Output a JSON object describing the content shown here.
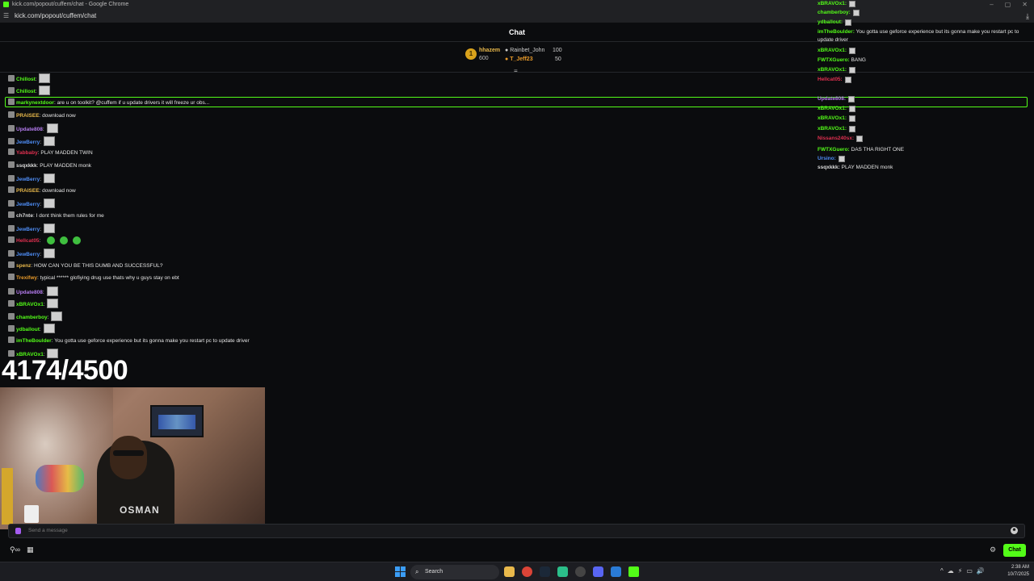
{
  "window": {
    "title": "kick.com/popout/cuffem/chat - Google Chrome",
    "url": "kick.com/popout/cuffem/chat"
  },
  "chat": {
    "header": "Chat",
    "input_placeholder": "Send a message",
    "chat_button": "Chat"
  },
  "leaderboard": {
    "first_name": "hhazem",
    "first_points": "600",
    "row1_name": "Rainbet_John",
    "row1_value": "100",
    "row2_name": "T_Jeff23",
    "row2_value": "50"
  },
  "overlay": {
    "counter": "4174/4500",
    "shirt_text": "OSMAN"
  },
  "messages": [
    {
      "user": "Chillost",
      "sep": ":",
      "text": "",
      "color": "#53fc18",
      "emote": true
    },
    {
      "user": "Chillost",
      "sep": ":",
      "text": "",
      "color": "#53fc18",
      "emote": true
    },
    {
      "user": "markynextdoor",
      "sep": ":",
      "text": "are u on toolkit? @cuffem if u update drivers it will freeze ur obs...",
      "color": "#53fc18",
      "emote": false
    },
    {
      "user": "PRAISEE",
      "sep": ":",
      "text": "download now",
      "color": "#e8b84b",
      "emote": false
    },
    {
      "user": "Update808",
      "sep": ":",
      "text": "",
      "color": "#b57cf0",
      "emote": true
    },
    {
      "user": "JewBerry",
      "sep": ":",
      "text": "",
      "color": "#4f8ef7",
      "emote": true
    },
    {
      "user": "Yabbaby",
      "sep": ":",
      "text": "PLAY MADDEN TWIN",
      "color": "#e03050",
      "emote": false
    },
    {
      "user": "ssqxkkk",
      "sep": ":",
      "text": "PLAY MADDEN monk",
      "color": "#dddddd",
      "emote": false
    },
    {
      "user": "JewBerry",
      "sep": ":",
      "text": "",
      "color": "#4f8ef7",
      "emote": true
    },
    {
      "user": "PRAISEE",
      "sep": ":",
      "text": "download now",
      "color": "#e8b84b",
      "emote": false
    },
    {
      "user": "JewBerry",
      "sep": ":",
      "text": "",
      "color": "#4f8ef7",
      "emote": true
    },
    {
      "user": "ch7nte",
      "sep": ":",
      "text": "I dont think them rules for me",
      "color": "#dddddd",
      "emote": false
    },
    {
      "user": "JewBerry",
      "sep": ":",
      "text": "",
      "color": "#4f8ef7",
      "emote": true
    },
    {
      "user": "Hellcat05",
      "sep": ":",
      "text": "",
      "color": "#e03050",
      "emote": false
    },
    {
      "user": "JewBerry",
      "sep": ":",
      "text": "",
      "color": "#4f8ef7",
      "emote": true
    },
    {
      "user": "spenz",
      "sep": ":",
      "text": "HOW CAN YOU BE THIS DUMB AND SUCCESSFUL?",
      "color": "#e8b84b",
      "emote": false
    },
    {
      "user": "Trexifwy",
      "sep": ":",
      "text": "typical ****** glofiying drug use thats why u guys stay on ebt",
      "color": "#e89a2a",
      "emote": false
    },
    {
      "user": "Update808",
      "sep": ":",
      "text": "",
      "color": "#b57cf0",
      "emote": true
    },
    {
      "user": "xBRAVOx1",
      "sep": ":",
      "text": "",
      "color": "#53fc18",
      "emote": true
    },
    {
      "user": "chamberboy",
      "sep": ":",
      "text": "",
      "color": "#53fc18",
      "emote": true
    },
    {
      "user": "ydballout",
      "sep": ":",
      "text": "",
      "color": "#53fc18",
      "emote": true
    },
    {
      "user": "imTheBoulder",
      "sep": ":",
      "text": "You gotta use geforce experience but its gonna make you restart pc to update driver",
      "color": "#53fc18",
      "emote": false
    },
    {
      "user": "xBRAVOx1",
      "sep": ":",
      "text": "",
      "color": "#53fc18",
      "emote": true
    }
  ],
  "right_messages": [
    {
      "user": "xBRAVOx1",
      "text": "",
      "color": "#53fc18"
    },
    {
      "user": "chamberboy",
      "text": "",
      "color": "#53fc18"
    },
    {
      "user": "ydballout",
      "text": "",
      "color": "#53fc18"
    },
    {
      "user": "imTheBoulder",
      "text": "You gotta use geforce experience but its gonna make you restart pc to update driver",
      "color": "#53fc18"
    },
    {
      "user": "xBRAVOx1",
      "text": "",
      "color": "#53fc18"
    },
    {
      "user": "FWTXGuero",
      "text": "BANG",
      "color": "#53fc18"
    },
    {
      "user": "xBRAVOx1",
      "text": "",
      "color": "#53fc18"
    },
    {
      "user": "Hellcat05",
      "text": "",
      "color": "#e03050"
    },
    {
      "user": "Update808",
      "text": "",
      "color": "#b57cf0"
    },
    {
      "user": "xBRAVOx1",
      "text": "",
      "color": "#53fc18"
    },
    {
      "user": "xBRAVOx1",
      "text": "",
      "color": "#53fc18"
    },
    {
      "user": "xBRAVOx1",
      "text": "",
      "color": "#53fc18"
    },
    {
      "user": "Nissans240sx",
      "text": "",
      "color": "#e03050"
    },
    {
      "user": "FWTXGuero",
      "text": "DAS THA RIGHT ONE",
      "color": "#53fc18"
    },
    {
      "user": "Ursino",
      "text": "",
      "color": "#4f8ef7"
    },
    {
      "user": "ssqxkkk",
      "text": "PLAY MADDEN monk",
      "color": "#dddddd"
    }
  ],
  "taskbar": {
    "search": "Search",
    "time": "2:38 AM",
    "date": "10/7/2025"
  },
  "colors": {
    "accent": "#53fc18",
    "bg": "#0b0c0e"
  }
}
